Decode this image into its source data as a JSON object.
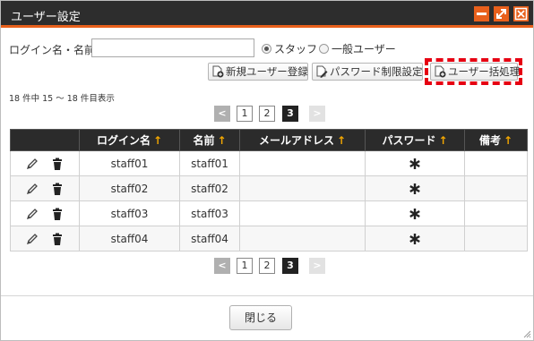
{
  "window": {
    "title": "ユーザー設定",
    "accent_color": "#e8601c",
    "titlebar_color": "#2d2d2d"
  },
  "search": {
    "label": "ログイン名・名前",
    "value": "",
    "placeholder": "",
    "radio_staff": "スタッフ",
    "radio_general": "一般ユーザー",
    "selected": "スタッフ"
  },
  "toolbar": {
    "new_user_label": "新規ユーザー登録",
    "password_limit_label": "パスワード制限設定",
    "bulk_user_label": "ユーザー括処理"
  },
  "range_text": "18 件中 15 〜 18 件目表示",
  "pagination": {
    "prev": "<",
    "pages": [
      "1",
      "2",
      "3"
    ],
    "current": "3",
    "next": ">"
  },
  "table": {
    "headers": [
      "",
      "ログイン名",
      "名前",
      "メールアドレス",
      "パスワード",
      "備考"
    ],
    "sort_arrow": "↑",
    "rows": [
      {
        "login": "staff01",
        "name": "staff01",
        "email": "",
        "note": ""
      },
      {
        "login": "staff02",
        "name": "staff02",
        "email": "",
        "note": ""
      },
      {
        "login": "staff03",
        "name": "staff03",
        "email": "",
        "note": ""
      },
      {
        "login": "staff04",
        "name": "staff04",
        "email": "",
        "note": ""
      }
    ],
    "row_icons": [
      "pencil-icon",
      "trash-icon"
    ],
    "password_icon": "asterisk-icon"
  },
  "footer": {
    "close_label": "閉じる"
  }
}
